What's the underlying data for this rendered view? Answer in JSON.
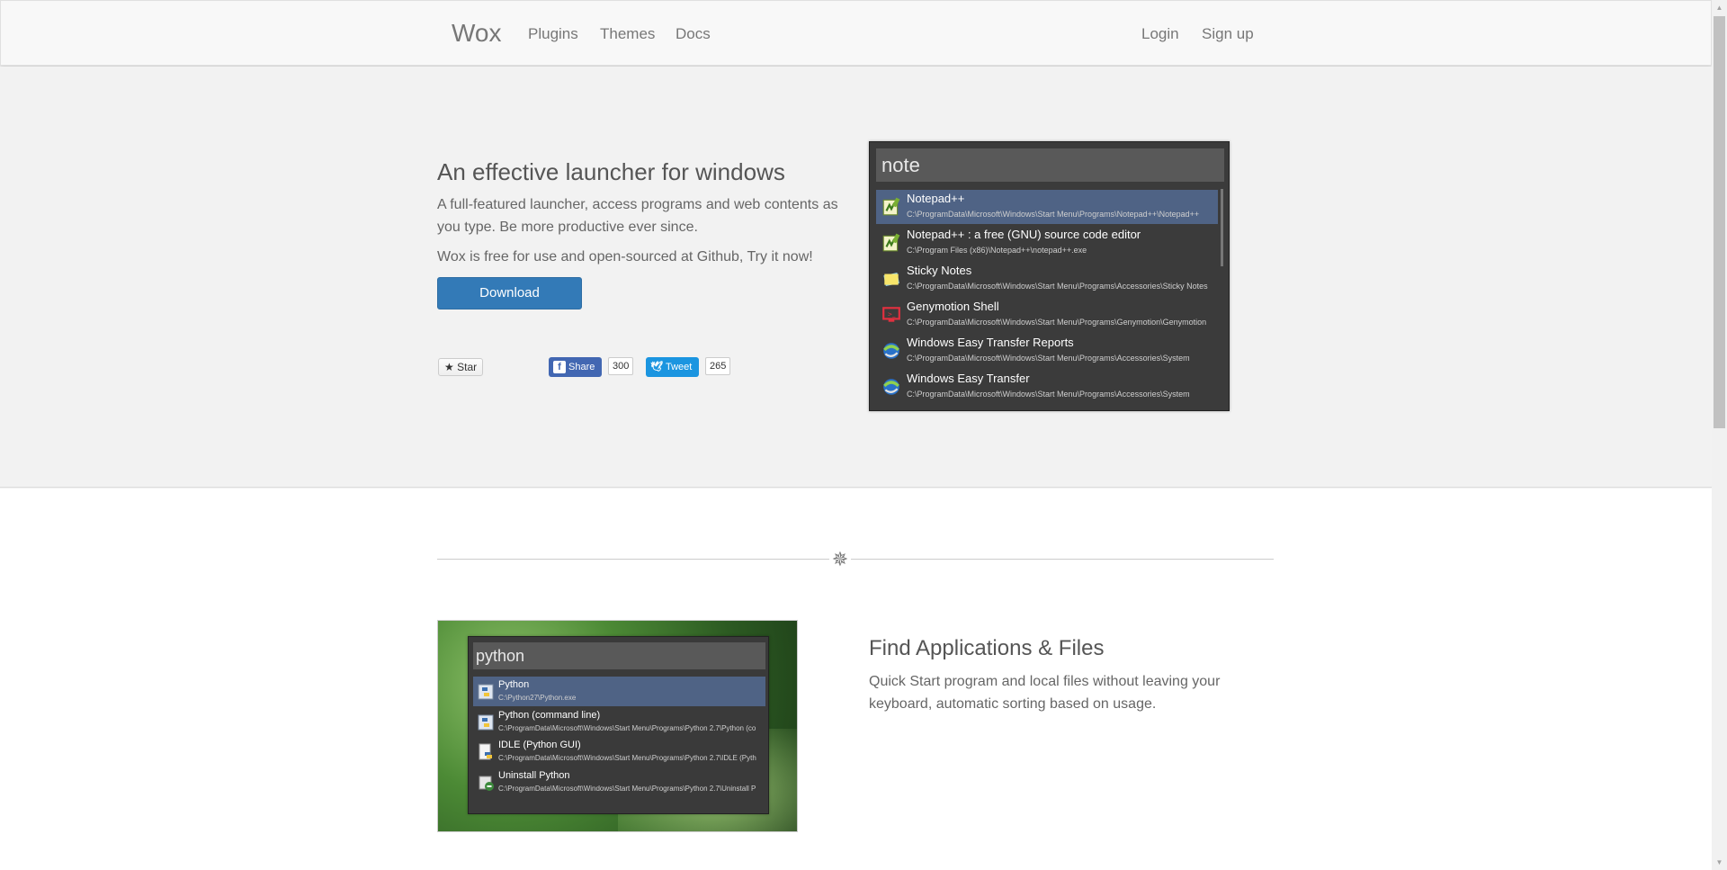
{
  "nav": {
    "brand": "Wox",
    "links": [
      "Plugins",
      "Themes",
      "Docs"
    ],
    "right_links": [
      "Login",
      "Sign up"
    ]
  },
  "hero": {
    "title": "An effective launcher for windows",
    "description": "A full-featured launcher, access programs and web contents as you type. Be more productive ever since.",
    "free_text": "Wox is free for use and open-sourced at Github, Try it now!",
    "download_label": "Download",
    "star_label": "Star",
    "share_label": "Share",
    "share_count": "300",
    "tweet_label": "Tweet",
    "tweet_count": "265"
  },
  "launcher_main": {
    "query": "note",
    "results": [
      {
        "name": "Notepad++",
        "path": "C:\\ProgramData\\Microsoft\\Windows\\Start Menu\\Programs\\Notepad++\\Notepad++",
        "icon": "notepadpp-icon",
        "selected": true
      },
      {
        "name": "Notepad++ : a free (GNU) source code editor",
        "path": "C:\\Program Files (x86)\\Notepad++\\notepad++.exe",
        "icon": "notepadpp-icon",
        "selected": false
      },
      {
        "name": "Sticky Notes",
        "path": "C:\\ProgramData\\Microsoft\\Windows\\Start Menu\\Programs\\Accessories\\Sticky Notes",
        "icon": "sticky-notes-icon",
        "selected": false
      },
      {
        "name": "Genymotion Shell",
        "path": "C:\\ProgramData\\Microsoft\\Windows\\Start Menu\\Programs\\Genymotion\\Genymotion",
        "icon": "genymotion-icon",
        "selected": false
      },
      {
        "name": "Windows Easy Transfer Reports",
        "path": "C:\\ProgramData\\Microsoft\\Windows\\Start Menu\\Programs\\Accessories\\System",
        "icon": "easy-transfer-icon",
        "selected": false
      },
      {
        "name": "Windows Easy Transfer",
        "path": "C:\\ProgramData\\Microsoft\\Windows\\Start Menu\\Programs\\Accessories\\System",
        "icon": "easy-transfer-icon",
        "selected": false
      }
    ]
  },
  "feature": {
    "title": "Find Applications & Files",
    "description": "Quick Start program and local files without leaving your keyboard, automatic sorting based on usage."
  },
  "launcher_python": {
    "query": "python",
    "results": [
      {
        "name": "Python",
        "path": "C:\\Python27\\Python.exe",
        "icon": "python-icon",
        "selected": true
      },
      {
        "name": "Python (command line)",
        "path": "C:\\ProgramData\\Microsoft\\Windows\\Start Menu\\Programs\\Python 2.7\\Python (co",
        "icon": "python-icon",
        "selected": false
      },
      {
        "name": "IDLE (Python GUI)",
        "path": "C:\\ProgramData\\Microsoft\\Windows\\Start Menu\\Programs\\Python 2.7\\IDLE (Pyth",
        "icon": "idle-icon",
        "selected": false
      },
      {
        "name": "Uninstall Python",
        "path": "C:\\ProgramData\\Microsoft\\Windows\\Start Menu\\Programs\\Python 2.7\\Uninstall P",
        "icon": "uninstall-icon",
        "selected": false
      }
    ]
  }
}
